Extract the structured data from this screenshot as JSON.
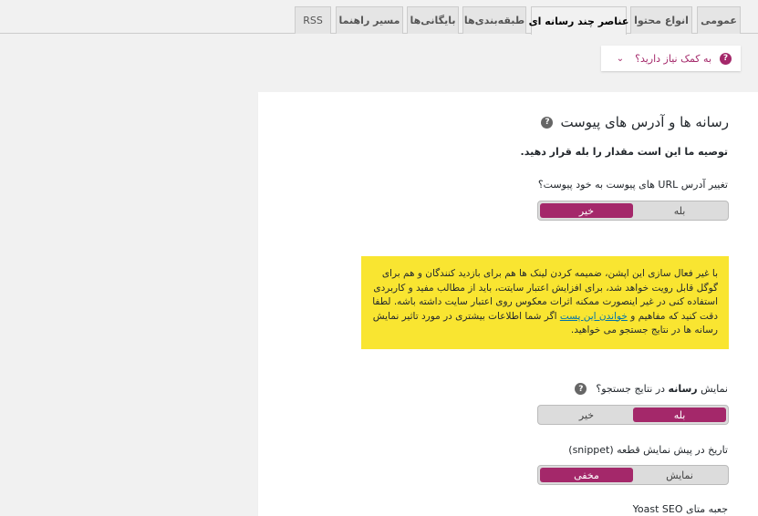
{
  "tabs": [
    {
      "label": "عمومی",
      "active": false
    },
    {
      "label": "انواع محتوا",
      "active": false
    },
    {
      "label": "عناصر چند رسانه ای",
      "active": true
    },
    {
      "label": "طبقه‌بندی‌ها",
      "active": false
    },
    {
      "label": "بایگانی‌ها",
      "active": false
    },
    {
      "label": "مسیر راهنما",
      "active": false
    },
    {
      "label": "RSS",
      "active": false
    }
  ],
  "help": {
    "label": "به کمک نیاز دارید؟",
    "icon": "question-icon",
    "chevron": "chevron-down-icon"
  },
  "section": {
    "title": "رسانه ها و آدرس های پیوست",
    "recommendation": "توصیه ما این است مقدار را بله قرار دهید."
  },
  "redirect": {
    "label": "تغییر آدرس URL های پیوست به خود پیوست؟",
    "yes": "بله",
    "no": "خیر",
    "selected": "no"
  },
  "alert": {
    "text_before": "با غیر فعال سازی این اپشن، ضمیمه کردن لینک ها هم برای بازدید کنندگان و هم برای گوگل قابل رویت خواهد شد، برای افزایش اعتبار سایتت، باید از مطالب مفید و کاربردی استفاده کنی در غیر اینصورت ممکنه اثرات معکوس روی اعتبار سایت داشته باشه. لطفا دقت کنید که مفاهیم و",
    "link": "خواندن این پست",
    "text_after": "اگر شما اطلاعات بیشتری در مورد تاثیر نمایش رسانه ها در نتایج جستجو می خواهید.",
    "color": "#f9e531"
  },
  "show_media": {
    "label_before": "نمایش",
    "label_bold": "رسانه",
    "label_after": "در نتایج جستجو؟",
    "yes": "بله",
    "no": "خیر",
    "selected": "yes"
  },
  "snippet_date": {
    "label": "تاریخ در پیش نمایش قطعه (snippet)",
    "show": "نمایش",
    "hide": "مخفی",
    "selected": "hide"
  },
  "meta_box": {
    "label": "جعبه متای Yoast SEO"
  },
  "colors": {
    "accent": "#a4286a",
    "alert": "#f9e531"
  }
}
